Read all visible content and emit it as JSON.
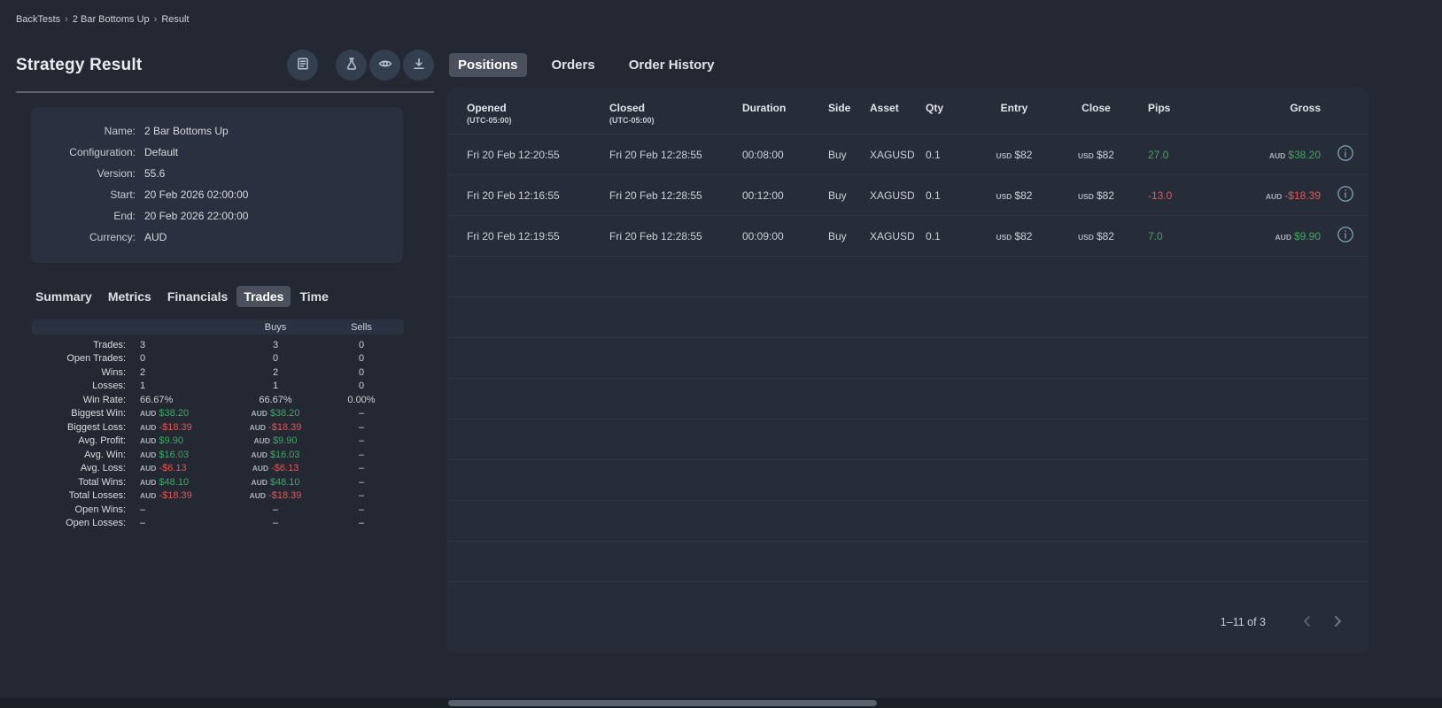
{
  "breadcrumb": {
    "items": [
      "BackTests",
      "2 Bar Bottoms Up",
      "Result"
    ],
    "separator": "›"
  },
  "colors": {
    "green": "#43a564",
    "red": "#e25555"
  },
  "left": {
    "title": "Strategy Result",
    "toolbar_icons": [
      "report-icon",
      "flask-icon",
      "eye-icon",
      "download-icon"
    ],
    "info": [
      {
        "label": "Name:",
        "value": "2 Bar Bottoms Up"
      },
      {
        "label": "Configuration:",
        "value": "Default"
      },
      {
        "label": "Version:",
        "value": "55.6"
      },
      {
        "label": "Start:",
        "value": "20 Feb 2026 02:00:00"
      },
      {
        "label": "End:",
        "value": "20 Feb 2026 22:00:00"
      },
      {
        "label": "Currency:",
        "value": "AUD"
      }
    ],
    "tabs": [
      "Summary",
      "Metrics",
      "Financials",
      "Trades",
      "Time"
    ],
    "active_tab": "Trades",
    "stats": {
      "headers": {
        "all": "",
        "buys": "Buys",
        "sells": "Sells"
      },
      "rows": [
        {
          "label": "Trades:",
          "cells": [
            "3",
            "3",
            "0"
          ]
        },
        {
          "label": "Open Trades:",
          "cells": [
            "0",
            "0",
            "0"
          ]
        },
        {
          "label": "Wins:",
          "cells": [
            "2",
            "2",
            "0"
          ]
        },
        {
          "label": "Losses:",
          "cells": [
            "1",
            "1",
            "0"
          ]
        },
        {
          "label": "Win Rate:",
          "cells": [
            "66.67%",
            "66.67%",
            "0.00%"
          ]
        },
        {
          "label": "Biggest Win:",
          "cells": [
            {
              "cur": "AUD",
              "amt": "$38.20",
              "tone": "green"
            },
            {
              "cur": "AUD",
              "amt": "$38.20",
              "tone": "green"
            },
            "–"
          ]
        },
        {
          "label": "Biggest Loss:",
          "cells": [
            {
              "cur": "AUD",
              "amt": "-$18.39",
              "tone": "red"
            },
            {
              "cur": "AUD",
              "amt": "-$18.39",
              "tone": "red"
            },
            "–"
          ]
        },
        {
          "label": "Avg. Profit:",
          "cells": [
            {
              "cur": "AUD",
              "amt": "$9.90",
              "tone": "green"
            },
            {
              "cur": "AUD",
              "amt": "$9.90",
              "tone": "green"
            },
            "–"
          ]
        },
        {
          "label": "Avg. Win:",
          "cells": [
            {
              "cur": "AUD",
              "amt": "$16.03",
              "tone": "green"
            },
            {
              "cur": "AUD",
              "amt": "$16.03",
              "tone": "green"
            },
            "–"
          ]
        },
        {
          "label": "Avg. Loss:",
          "cells": [
            {
              "cur": "AUD",
              "amt": "-$6.13",
              "tone": "red"
            },
            {
              "cur": "AUD",
              "amt": "-$6.13",
              "tone": "red"
            },
            "–"
          ]
        },
        {
          "label": "Total Wins:",
          "cells": [
            {
              "cur": "AUD",
              "amt": "$48.10",
              "tone": "green"
            },
            {
              "cur": "AUD",
              "amt": "$48.10",
              "tone": "green"
            },
            "–"
          ]
        },
        {
          "label": "Total Losses:",
          "cells": [
            {
              "cur": "AUD",
              "amt": "-$18.39",
              "tone": "red"
            },
            {
              "cur": "AUD",
              "amt": "-$18.39",
              "tone": "red"
            },
            "–"
          ]
        },
        {
          "label": "Open Wins:",
          "cells": [
            "–",
            "–",
            "–"
          ]
        },
        {
          "label": "Open Losses:",
          "cells": [
            "–",
            "–",
            "–"
          ]
        }
      ]
    }
  },
  "right": {
    "tabs": [
      "Positions",
      "Orders",
      "Order History"
    ],
    "active_tab": "Positions",
    "table": {
      "columns": [
        {
          "label": "Opened",
          "sub": "(UTC-05:00)"
        },
        {
          "label": "Closed",
          "sub": "(UTC-05:00)"
        },
        {
          "label": "Duration"
        },
        {
          "label": "Side"
        },
        {
          "label": "Asset"
        },
        {
          "label": "Qty"
        },
        {
          "label": "Entry"
        },
        {
          "label": "Close"
        },
        {
          "label": "Pips"
        },
        {
          "label": "Gross"
        },
        {
          "label": ""
        }
      ],
      "rows": [
        {
          "opened": "Fri 20 Feb 12:20:55",
          "closed": "Fri 20 Feb 12:28:55",
          "duration": "00:08:00",
          "side": "Buy",
          "asset": "XAGUSD",
          "qty": "0.1",
          "entry": {
            "cur": "USD",
            "amt": "$82"
          },
          "close": {
            "cur": "USD",
            "amt": "$82"
          },
          "pips": {
            "text": "27.0",
            "tone": "green"
          },
          "gross": {
            "cur": "AUD",
            "amt": "$38.20",
            "tone": "green"
          }
        },
        {
          "opened": "Fri 20 Feb 12:16:55",
          "closed": "Fri 20 Feb 12:28:55",
          "duration": "00:12:00",
          "side": "Buy",
          "asset": "XAGUSD",
          "qty": "0.1",
          "entry": {
            "cur": "USD",
            "amt": "$82"
          },
          "close": {
            "cur": "USD",
            "amt": "$82"
          },
          "pips": {
            "text": "-13.0",
            "tone": "red"
          },
          "gross": {
            "cur": "AUD",
            "amt": "-$18.39",
            "tone": "red"
          }
        },
        {
          "opened": "Fri 20 Feb 12:19:55",
          "closed": "Fri 20 Feb 12:28:55",
          "duration": "00:09:00",
          "side": "Buy",
          "asset": "XAGUSD",
          "qty": "0.1",
          "entry": {
            "cur": "USD",
            "amt": "$82"
          },
          "close": {
            "cur": "USD",
            "amt": "$82"
          },
          "pips": {
            "text": "7.0",
            "tone": "green"
          },
          "gross": {
            "cur": "AUD",
            "amt": "$9.90",
            "tone": "green"
          }
        }
      ]
    },
    "pagination": {
      "range_label": "1–11 of 3"
    }
  }
}
